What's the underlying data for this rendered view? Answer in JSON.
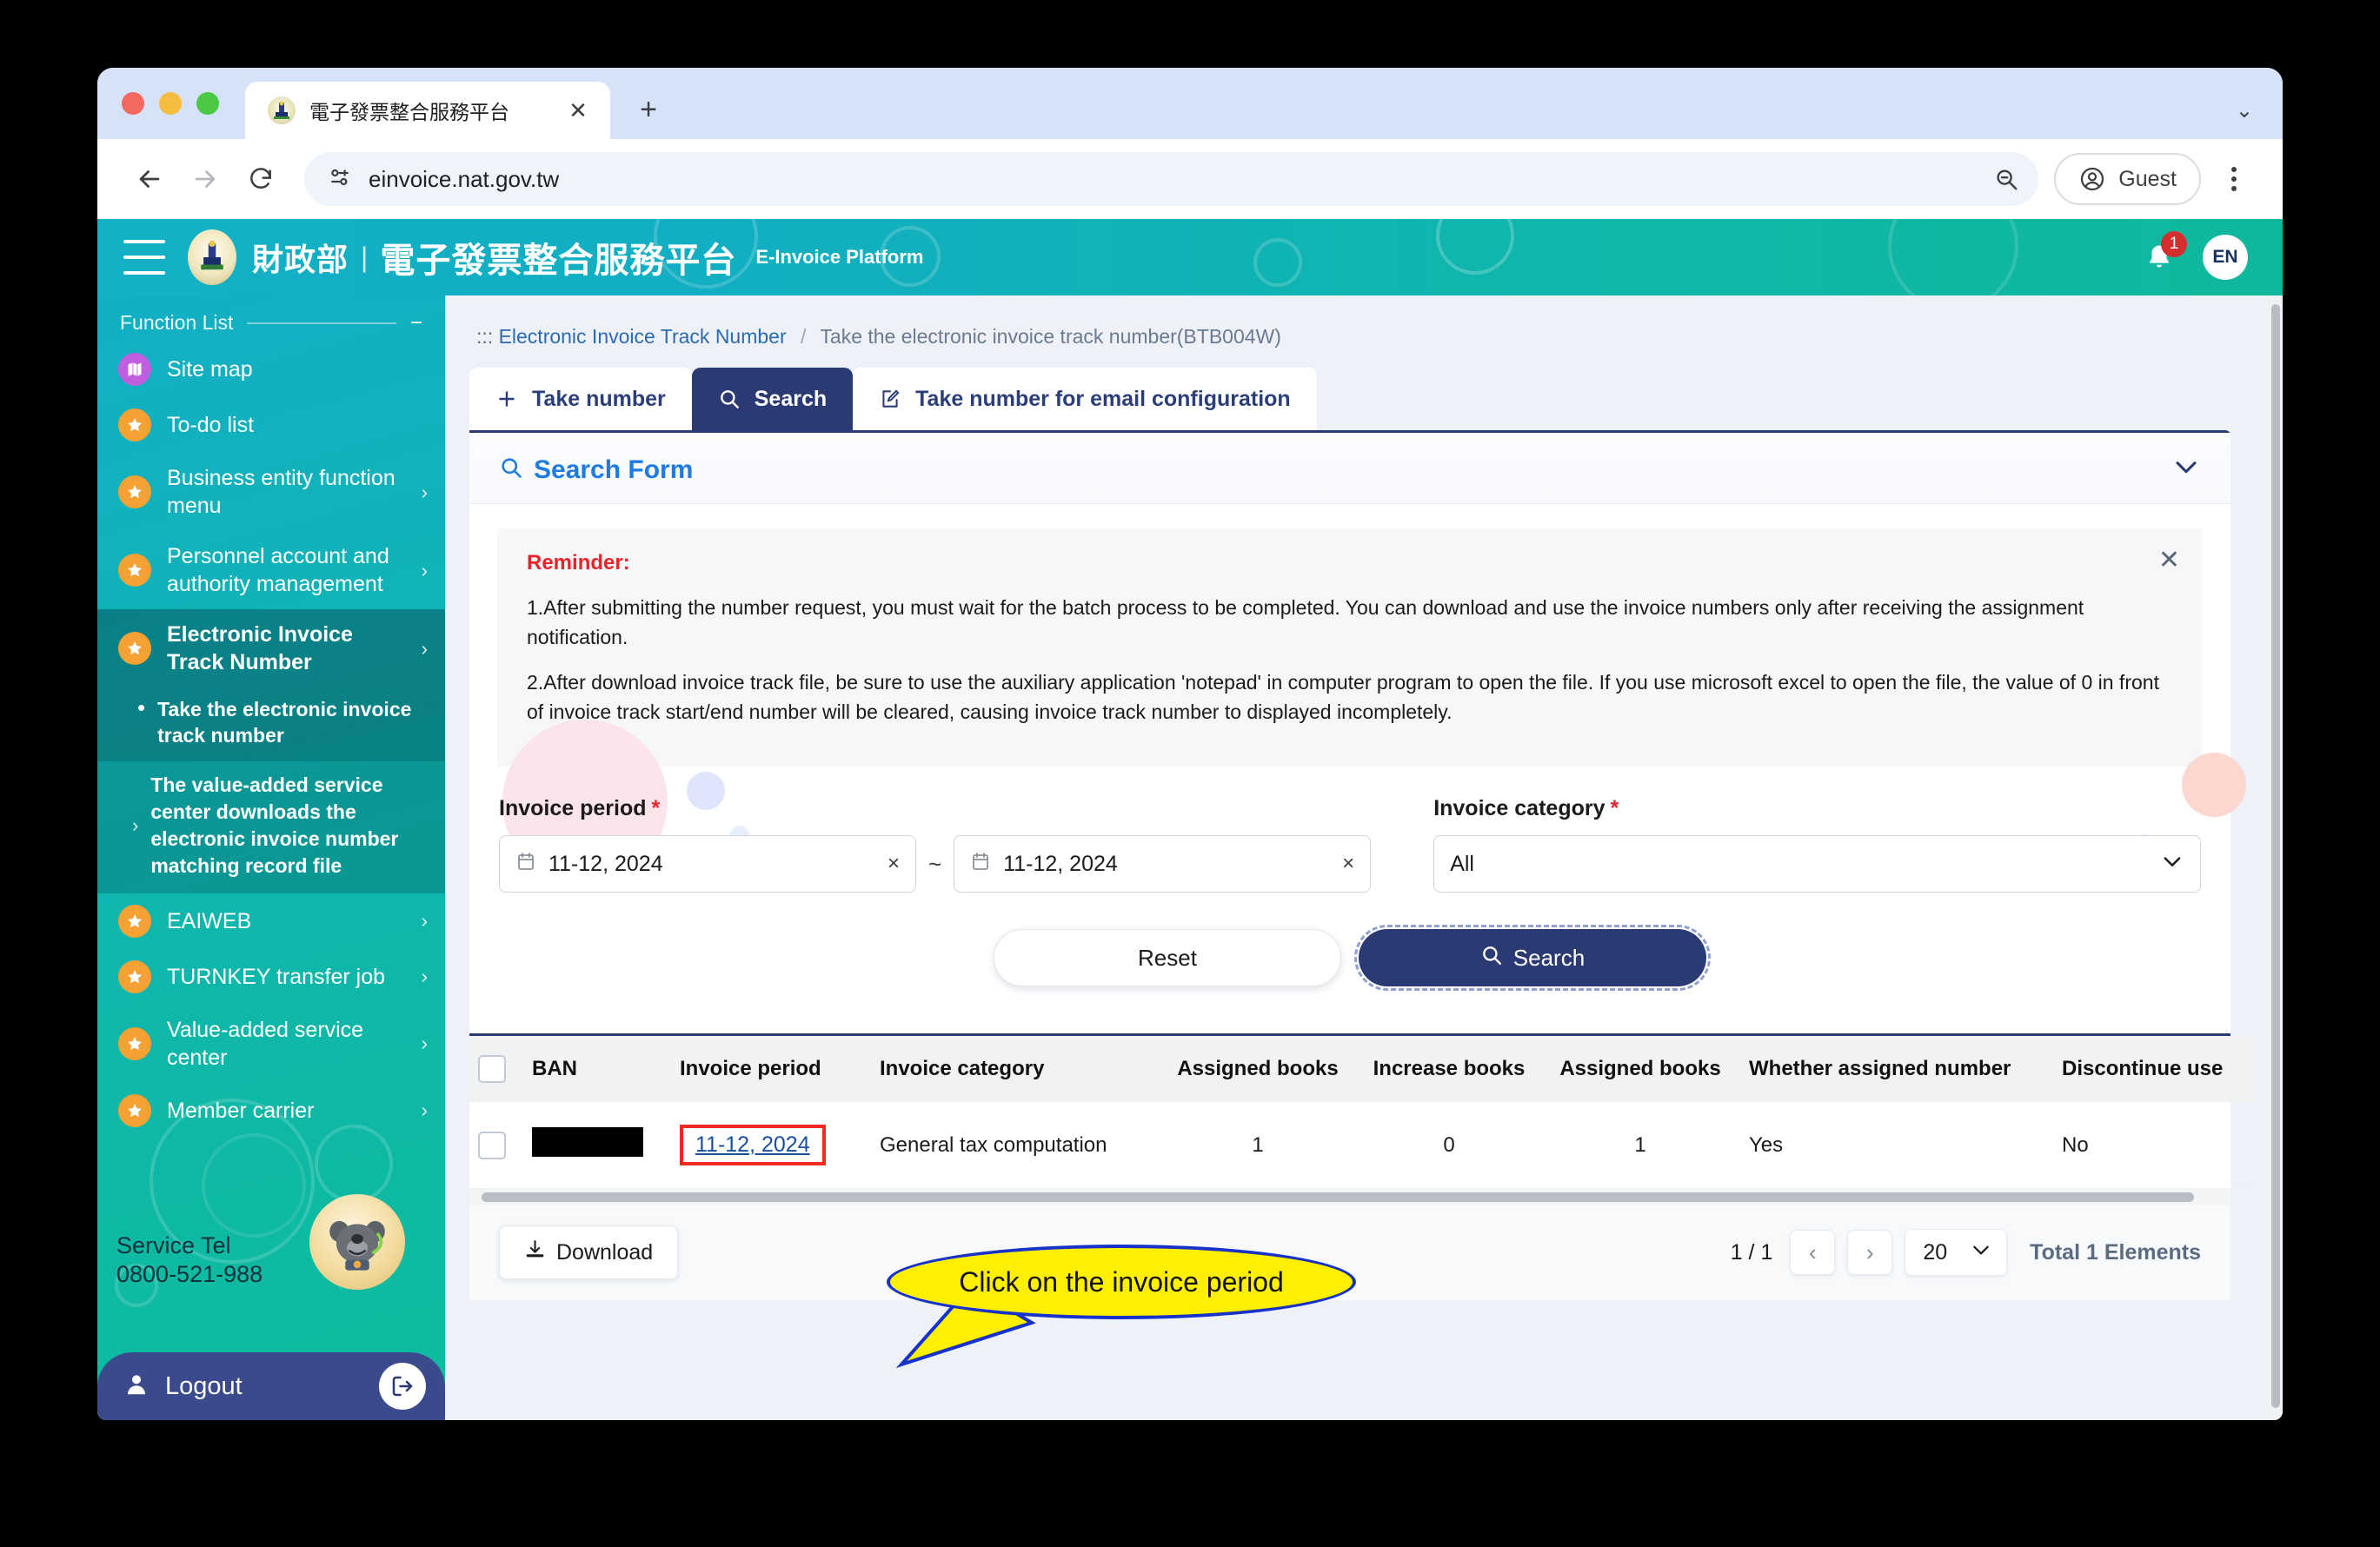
{
  "browser": {
    "tab_title": "電子發票整合服務平台",
    "tab_close_icon": "close-icon",
    "new_tab_icon": "plus-icon",
    "url": "einvoice.nat.gov.tw",
    "profile_label": "Guest"
  },
  "site_header": {
    "title_zh_ministry": "財政部",
    "separator": "|",
    "title_main": "電子發票整合服務平台",
    "title_en": "E-Invoice Platform",
    "notification_count": "1",
    "language": "EN"
  },
  "sidebar": {
    "heading": "Function List",
    "collapse_glyph": "−",
    "items": [
      {
        "label": "Site map",
        "icon": "map-icon",
        "accent": "#bf5fe0",
        "chevron": ""
      },
      {
        "label": "To-do list",
        "icon": "star-icon",
        "accent": "#f5a133",
        "chevron": ""
      },
      {
        "label": "Business entity function menu",
        "icon": "star-icon",
        "accent": "#f5a133",
        "chevron": "›"
      },
      {
        "label": "Personnel account and authority management",
        "icon": "star-icon",
        "accent": "#f5a133",
        "chevron": "›"
      },
      {
        "label": "Electronic Invoice Track Number",
        "icon": "star-icon",
        "accent": "#f5a133",
        "chevron": "›"
      }
    ],
    "sub_active": "Take the electronic invoice track number",
    "sub_second": "The value-added service center downloads the electronic invoice number matching record file",
    "items_after": [
      {
        "label": "EAIWEB",
        "icon": "star-icon",
        "accent": "#f5a133",
        "chevron": "›"
      },
      {
        "label": "TURNKEY transfer job",
        "icon": "star-icon",
        "accent": "#f5a133",
        "chevron": "›"
      },
      {
        "label": "Value-added service center",
        "icon": "star-icon",
        "accent": "#f5a133",
        "chevron": "›"
      },
      {
        "label": "Member carrier",
        "icon": "star-icon",
        "accent": "#f5a133",
        "chevron": "›"
      }
    ],
    "service_tel_label": "Service Tel",
    "service_tel_number": "0800-521-988",
    "logout_label": "Logout"
  },
  "breadcrumb": {
    "prefix": ":::",
    "parent": "Electronic Invoice Track Number",
    "separator": "/",
    "current": "Take the electronic invoice track number(BTB004W)"
  },
  "tabs": [
    {
      "label": "Take number",
      "icon": "plus-icon",
      "active": false
    },
    {
      "label": "Search",
      "icon": "search-icon",
      "active": true
    },
    {
      "label": "Take number for email configuration",
      "icon": "edit-icon",
      "active": false
    }
  ],
  "card": {
    "title": "Search Form",
    "title_icon": "search-icon",
    "collapse_icon": "chevron-down-icon"
  },
  "reminder": {
    "title": "Reminder:",
    "lines": [
      "1.After submitting the number request, you must wait for the batch process to be completed. You can download and use the invoice numbers only after receiving the assignment notification.",
      "2.After download invoice track file, be sure to use the auxiliary application 'notepad' in computer program to open the file. If you use microsoft excel to open the file, the value of 0 in front of invoice track start/end number will be cleared, causing invoice track number to displayed incompletely."
    ],
    "close_icon": "close-icon"
  },
  "form": {
    "period_label": "Invoice period",
    "period_required": "*",
    "period_from": "11-12, 2024",
    "period_to": "11-12, 2024",
    "period_range_sep": "~",
    "period_clear_glyph": "×",
    "calendar_icon": "calendar-icon",
    "category_label": "Invoice category",
    "category_required": "*",
    "category_value": "All",
    "category_caret": "chevron-down-icon",
    "reset_label": "Reset",
    "search_label": "Search",
    "search_icon": "search-icon"
  },
  "annotation": {
    "callout_text": "Click on the invoice period",
    "bubble_fill": "#ffef00",
    "bubble_stroke": "#1632c8",
    "highlight_stroke": "#ee2b20"
  },
  "table": {
    "columns": [
      "",
      "BAN",
      "Invoice period",
      "Invoice category",
      "Assigned books",
      "Increase books",
      "Assigned books",
      "Whether assigned number",
      "Discontinue use"
    ],
    "rows": [
      {
        "checkbox": "",
        "ban": "",
        "invoice_period": "11-12, 2024",
        "invoice_category": "General tax computation",
        "assigned_books": "1",
        "increase_books": "0",
        "assigned_books_2": "1",
        "whether_assigned_number": "Yes",
        "discontinue_use": "No"
      }
    ]
  },
  "footer": {
    "download_label": "Download",
    "download_icon": "download-icon",
    "page_indicator": "1 / 1",
    "prev_glyph": "‹",
    "next_glyph": "›",
    "page_size": "20",
    "page_size_caret": "chevron-down-icon",
    "total_label": "Total 1 Elements"
  }
}
